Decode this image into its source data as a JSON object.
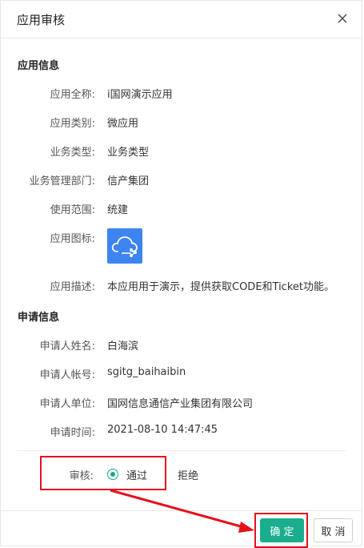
{
  "dialog": {
    "title": "应用审核",
    "close_icon": "close-icon"
  },
  "app_info": {
    "section_title": "应用信息",
    "full_name_label": "应用全称:",
    "full_name": "i国网演示应用",
    "category_label": "应用类别:",
    "category": "微应用",
    "business_type_label": "业务类型:",
    "business_type": "业务类型",
    "department_label": "业务管理部门:",
    "department": "信产集团",
    "scope_label": "使用范围:",
    "scope": "统建",
    "icon_label": "应用图标:",
    "app_icon": "cloud-share-icon",
    "description_label": "应用描述:",
    "description": "本应用用于演示，提供获取CODE和Ticket功能。"
  },
  "applicant_info": {
    "section_title": "申请信息",
    "name_label": "申请人姓名:",
    "name": "白海滨",
    "account_label": "申请人帐号:",
    "account": "sgitg_baihaibin",
    "unit_label": "申请人单位:",
    "unit": "国网信息通信产业集团有限公司",
    "time_label": "申请时间:",
    "time": "2021-08-10 14:47:45"
  },
  "review": {
    "label": "审核:",
    "options": [
      "通过",
      "拒绝"
    ],
    "selected": "通过"
  },
  "footer": {
    "confirm_label": "确 定",
    "cancel_label": "取 消"
  },
  "colors": {
    "accent": "#1aae8e",
    "highlight": "#e3121b",
    "icon_bg": "#3d84f0"
  }
}
